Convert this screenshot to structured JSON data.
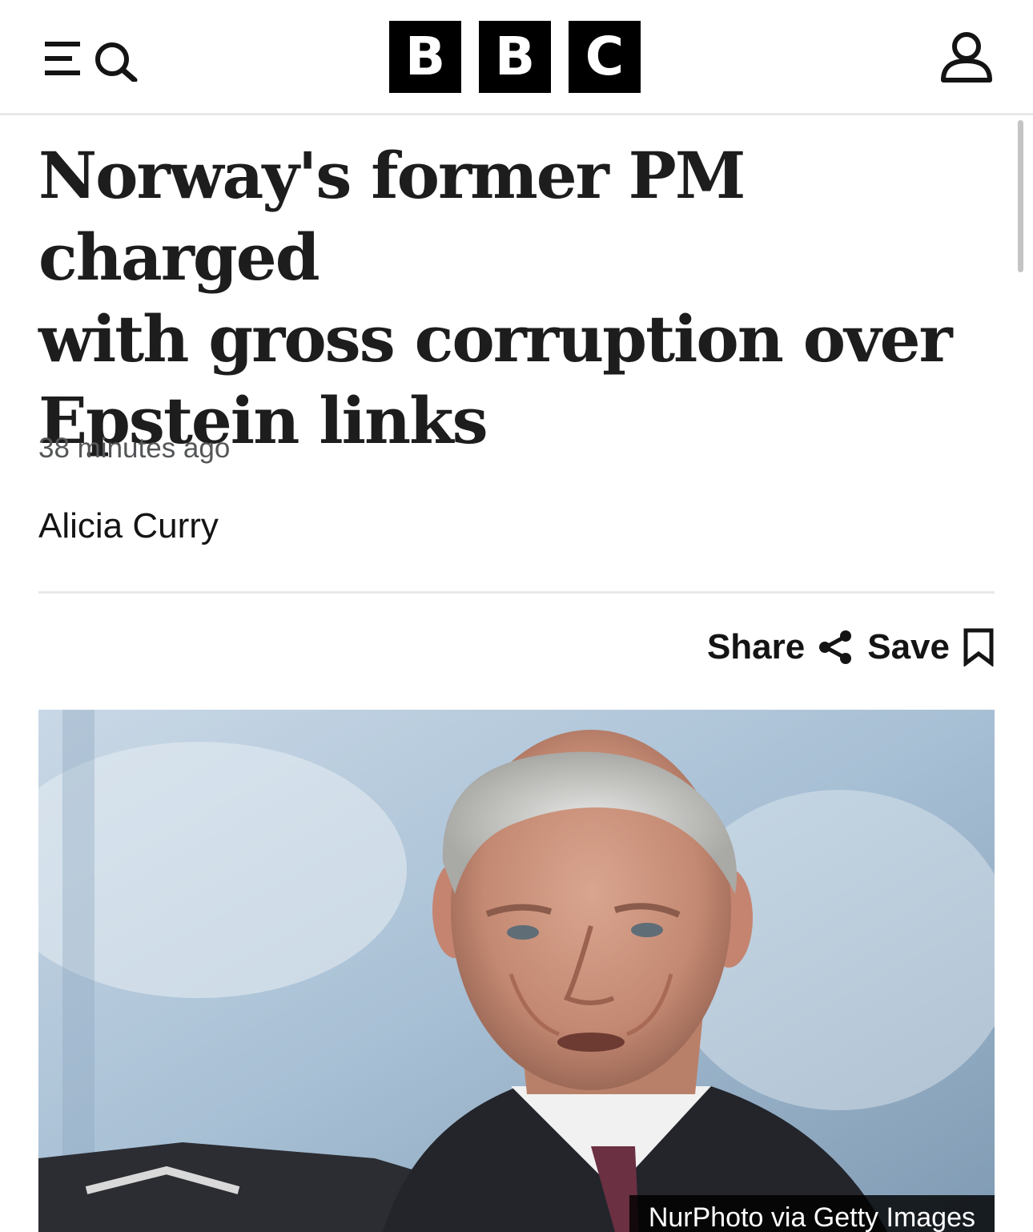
{
  "header": {
    "logo_letters": [
      "B",
      "B",
      "C"
    ],
    "icons": {
      "menu": "menu-icon",
      "search": "search-icon",
      "account": "account-icon"
    }
  },
  "article": {
    "headline_lines": [
      "Norway's former PM charged",
      "with gross corruption over",
      "Epstein links"
    ],
    "timestamp": "38 minutes ago",
    "author": "Alicia Curry",
    "actions": {
      "share_label": "Share",
      "save_label": "Save",
      "share_icon": "share-icon",
      "save_icon": "bookmark-icon"
    },
    "image": {
      "caption": "NurPhoto via Getty Images"
    }
  }
}
